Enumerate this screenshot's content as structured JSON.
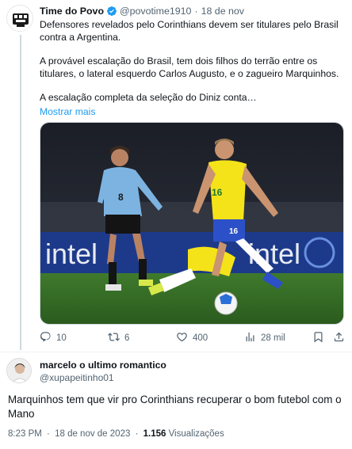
{
  "tweet": {
    "author_name": "Time do Povo",
    "author_handle": "@povotime1910",
    "separator": "·",
    "date": "18 de nov",
    "paragraphs": [
      "Defensores revelados pelo Corinthians devem ser titulares pelo Brasil contra a Argentina.",
      "A provável escalação do Brasil, tem dois filhos do terrão entre os titulares, o lateral esquerdo Carlos Augusto, e o zagueiro Marquinhos.",
      "A escalação completa da seleção do Diniz conta…"
    ],
    "show_more": "Mostrar mais",
    "media": {
      "ad_text": "intel",
      "jersey_left": "8",
      "jersey_right": "16",
      "shorts_right": "16"
    },
    "actions": {
      "replies": "10",
      "retweets": "6",
      "likes": "400",
      "views": "28 mil"
    }
  },
  "reply": {
    "author_name": "marcelo o ultimo romantico",
    "author_handle": "@xupapeitinho01",
    "text": "Marquinhos tem que vir pro Corinthians recuperar o bom futebol com o Mano",
    "time": "8:23 PM",
    "separator": "·",
    "date": "18 de nov de 2023",
    "views_count": "1.156",
    "views_label": "Visualizações"
  },
  "colors": {
    "accent": "#1d9bf0",
    "muted": "#536471",
    "text": "#0f1419",
    "brazil_yellow": "#f5e31a",
    "uruguay_blue": "#7db3e0"
  },
  "icons": [
    "verified-badge-icon",
    "reply-icon",
    "retweet-icon",
    "like-icon",
    "views-icon",
    "bookmark-icon",
    "share-icon"
  ]
}
